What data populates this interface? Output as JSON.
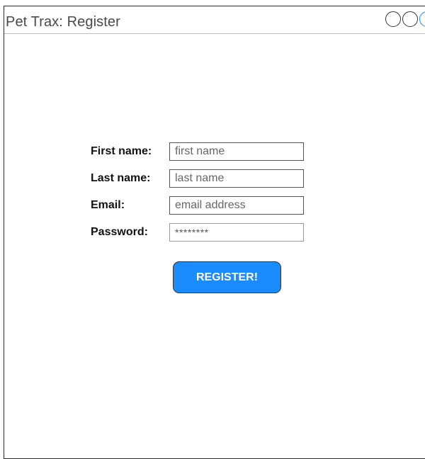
{
  "window": {
    "title": "Pet Trax: Register",
    "controls": [
      "window-circle",
      "window-circle",
      "window-circle"
    ]
  },
  "form": {
    "first_name": {
      "label": "First name:",
      "placeholder": "first name",
      "value": ""
    },
    "last_name": {
      "label": "Last name:",
      "placeholder": "last name",
      "value": ""
    },
    "email": {
      "label": "Email:",
      "placeholder": "email address",
      "value": ""
    },
    "password": {
      "label": "Password:",
      "value": "********"
    },
    "submit_label": "REGISTER!"
  },
  "colors": {
    "accent": "#1a8cff",
    "border": "#2b2b2b"
  }
}
